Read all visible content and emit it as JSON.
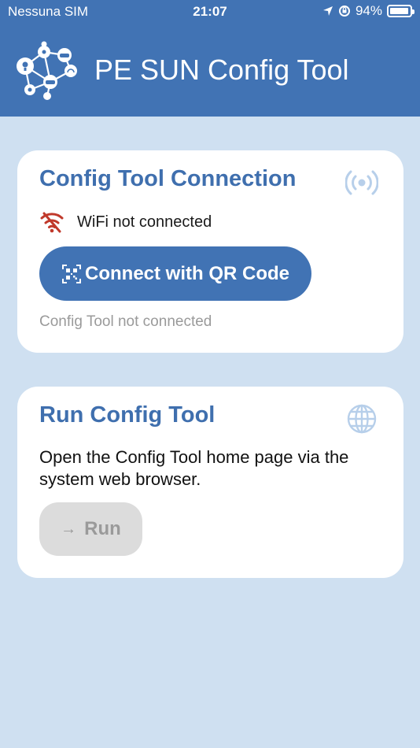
{
  "status_bar": {
    "carrier": "Nessuna SIM",
    "time": "21:07",
    "battery": "94%",
    "battery_level": 0.94
  },
  "header": {
    "title": "PE SUN Config Tool",
    "background": "#4173b4"
  },
  "connection_card": {
    "title": "Config Tool Connection",
    "icon": "broadcast-icon",
    "wifi_status": "WiFi not connected",
    "wifi_icon": "wifi-off-icon",
    "connect_label": "Connect with QR Code",
    "connect_icon": "qr-code-icon",
    "status": "Config Tool not connected"
  },
  "run_card": {
    "title": "Run Config Tool",
    "icon": "globe-icon",
    "description": "Open the Config Tool home page via the system web browser.",
    "run_label": "Run",
    "run_icon": "arrow-right-icon"
  },
  "colors": {
    "accent": "#4173b4",
    "title": "#3f6fae",
    "background": "#cfe0f1",
    "wifi_off": "#c0392b",
    "disabled": "#dcdcdc"
  }
}
